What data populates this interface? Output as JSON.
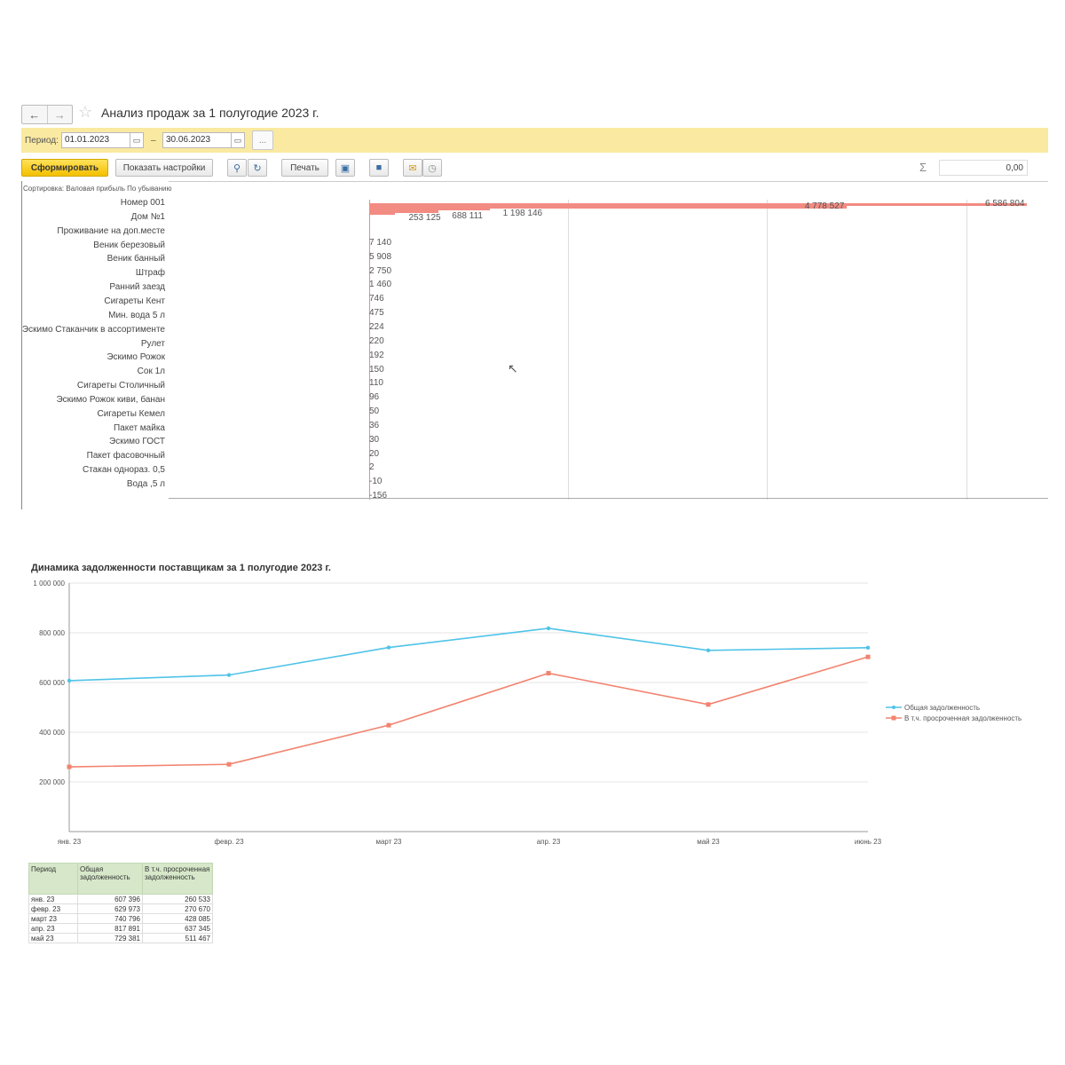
{
  "header": {
    "back_icon": "←",
    "forward_icon": "→",
    "favorite_icon": "☆",
    "title": "Анализ продаж за 1 полугодие 2023 г."
  },
  "period": {
    "label": "Период:",
    "from": "01.01.2023",
    "dash": "–",
    "to": "30.06.2023",
    "more": "..."
  },
  "toolbar": {
    "generate": "Сформировать",
    "show_settings": "Показать настройки",
    "print": "Печать",
    "sum_symbol": "Σ",
    "sum_value": "0,00"
  },
  "report": {
    "sort_line": "Сортировка: Валовая прибыль По убыванию",
    "items": [
      {
        "name": "Номер 001",
        "label": "6 586 804",
        "value": 6586804
      },
      {
        "name": "Дом №1",
        "label": "4 778 527",
        "value": 4778527
      },
      {
        "name": "Проживание на доп.месте",
        "label": "1 198 146",
        "value": 1198146
      },
      {
        "name": "Веник березовый",
        "label": "688 111",
        "value": 688111
      },
      {
        "name": "Веник банный",
        "label": "253 125",
        "value": 253125
      },
      {
        "name": "Штраф",
        "label": "7 140",
        "value": 7140
      },
      {
        "name": "Ранний заезд",
        "label": "5 908",
        "value": 5908
      },
      {
        "name": "Сигареты Кент",
        "label": "2 750",
        "value": 2750
      },
      {
        "name": "Мин. вода 5 л",
        "label": "1 460",
        "value": 1460
      },
      {
        "name": "Эскимо Стаканчик в ассортименте",
        "label": "746",
        "value": 746
      },
      {
        "name": "Рулет",
        "label": "475",
        "value": 475
      },
      {
        "name": "Эскимо Рожок",
        "label": "224",
        "value": 224
      },
      {
        "name": "Сок 1л",
        "label": "220",
        "value": 220
      },
      {
        "name": "Сигареты Столичный",
        "label": "192",
        "value": 192
      },
      {
        "name": "Эскимо Рожок киви, банан",
        "label": "150",
        "value": 150
      },
      {
        "name": "Сигареты Кемел",
        "label": "110",
        "value": 110
      },
      {
        "name": "Пакет майка",
        "label": "96",
        "value": 96
      },
      {
        "name": "Эскимо ГОСТ",
        "label": "50",
        "value": 50
      },
      {
        "name": "Пакет фасовочный",
        "label": "36",
        "value": 36
      },
      {
        "name": "Стакан однораз. 0,5",
        "label": "30",
        "value": 30
      },
      {
        "name": "Вода ,5 л",
        "label": "20",
        "value": 20
      },
      {
        "name": "",
        "label": "2",
        "value": 2
      },
      {
        "name": "",
        "label": "-10",
        "value": -10
      },
      {
        "name": "",
        "label": "-156",
        "value": -156
      }
    ]
  },
  "chart_data": {
    "type": "line",
    "title": "Динамика задолженности поставщикам за 1 полугодие 2023 г.",
    "categories": [
      "янв. 23",
      "февр. 23",
      "март 23",
      "апр. 23",
      "май 23",
      "июнь 23"
    ],
    "ylim": [
      0,
      1000000
    ],
    "yticks": [
      "1 000 000",
      "800 000",
      "600 000",
      "400 000",
      "200 000"
    ],
    "ytick_values": [
      1000000,
      800000,
      600000,
      400000,
      200000
    ],
    "grid": true,
    "legend_position": "right",
    "series": [
      {
        "name": "Общая задолженность",
        "color": "#4fc3e8",
        "values": [
          607396,
          629973,
          740796,
          817891,
          729381,
          740000
        ]
      },
      {
        "name": "В т.ч. просроченная задолженность",
        "color": "#f2836f",
        "values": [
          260533,
          270670,
          428085,
          637345,
          511467,
          703000
        ]
      }
    ]
  },
  "table": {
    "headers": [
      "Период",
      "Общая задолженность",
      "В т.ч. просроченная задолженность"
    ],
    "rows": [
      [
        "янв. 23",
        "607 396",
        "260 533"
      ],
      [
        "февр. 23",
        "629 973",
        "270 670"
      ],
      [
        "март 23",
        "740 796",
        "428 085"
      ],
      [
        "апр. 23",
        "817 891",
        "637 345"
      ],
      [
        "май 23",
        "729 381",
        "511 467"
      ]
    ]
  }
}
